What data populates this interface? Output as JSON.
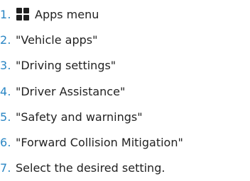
{
  "steps": [
    {
      "number": "1.",
      "icon": "apps-grid-icon",
      "text": "Apps menu"
    },
    {
      "number": "2.",
      "text": "\"Vehicle apps\""
    },
    {
      "number": "3.",
      "text": "\"Driving settings\""
    },
    {
      "number": "4.",
      "text": "\"Driver Assistance\""
    },
    {
      "number": "5.",
      "text": "\"Safety and warnings\""
    },
    {
      "number": "6.",
      "text": "\"Forward Collision Mitigation\""
    },
    {
      "number": "7.",
      "text": "Select the desired setting."
    }
  ],
  "colors": {
    "number": "#2a86c4",
    "text": "#222222",
    "icon": "#1f1f1f"
  }
}
